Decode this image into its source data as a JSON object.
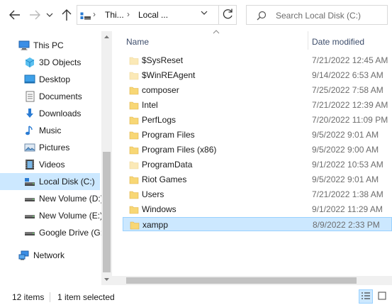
{
  "address": {
    "crumbs": [
      "Thi...",
      "Local ..."
    ]
  },
  "search": {
    "placeholder": "Search Local Disk (C:)"
  },
  "nav": {
    "items": [
      {
        "label": "This PC",
        "icon": "this-pc-icon"
      },
      {
        "label": "3D Objects",
        "icon": "3d-objects-icon"
      },
      {
        "label": "Desktop",
        "icon": "desktop-icon"
      },
      {
        "label": "Documents",
        "icon": "documents-icon"
      },
      {
        "label": "Downloads",
        "icon": "downloads-icon"
      },
      {
        "label": "Music",
        "icon": "music-icon"
      },
      {
        "label": "Pictures",
        "icon": "pictures-icon"
      },
      {
        "label": "Videos",
        "icon": "videos-icon"
      },
      {
        "label": "Local Disk (C:)",
        "icon": "local-disk-icon",
        "selected": true
      },
      {
        "label": "New Volume (D:)",
        "icon": "drive-icon"
      },
      {
        "label": "New Volume (E:)",
        "icon": "drive-icon"
      },
      {
        "label": "Google Drive (G:)",
        "icon": "drive-icon"
      },
      {
        "label": "Network",
        "icon": "network-icon"
      }
    ]
  },
  "columns": {
    "name": "Name",
    "date": "Date modified"
  },
  "files": [
    {
      "name": "$SysReset",
      "date": "7/21/2022 12:45 AM",
      "faded": true
    },
    {
      "name": "$WinREAgent",
      "date": "9/14/2022 6:53 AM",
      "faded": true
    },
    {
      "name": "composer",
      "date": "7/25/2022 7:58 AM"
    },
    {
      "name": "Intel",
      "date": "7/21/2022 12:39 AM"
    },
    {
      "name": "PerfLogs",
      "date": "7/20/2022 11:09 PM"
    },
    {
      "name": "Program Files",
      "date": "9/5/2022 9:01 AM"
    },
    {
      "name": "Program Files (x86)",
      "date": "9/5/2022 9:00 AM"
    },
    {
      "name": "ProgramData",
      "date": "9/1/2022 10:53 AM",
      "faded": true
    },
    {
      "name": "Riot Games",
      "date": "9/5/2022 9:01 AM"
    },
    {
      "name": "Users",
      "date": "7/21/2022 1:38 AM"
    },
    {
      "name": "Windows",
      "date": "9/1/2022 11:29 AM"
    },
    {
      "name": "xampp",
      "date": "8/9/2022 2:33 PM",
      "selected": true
    }
  ],
  "status": {
    "count": "12 items",
    "selection": "1 item selected"
  },
  "colors": {
    "folder": "#f8d775",
    "folder_faded": "#fbe9b7",
    "selection": "#cce8ff",
    "accent": "#0078d7"
  }
}
